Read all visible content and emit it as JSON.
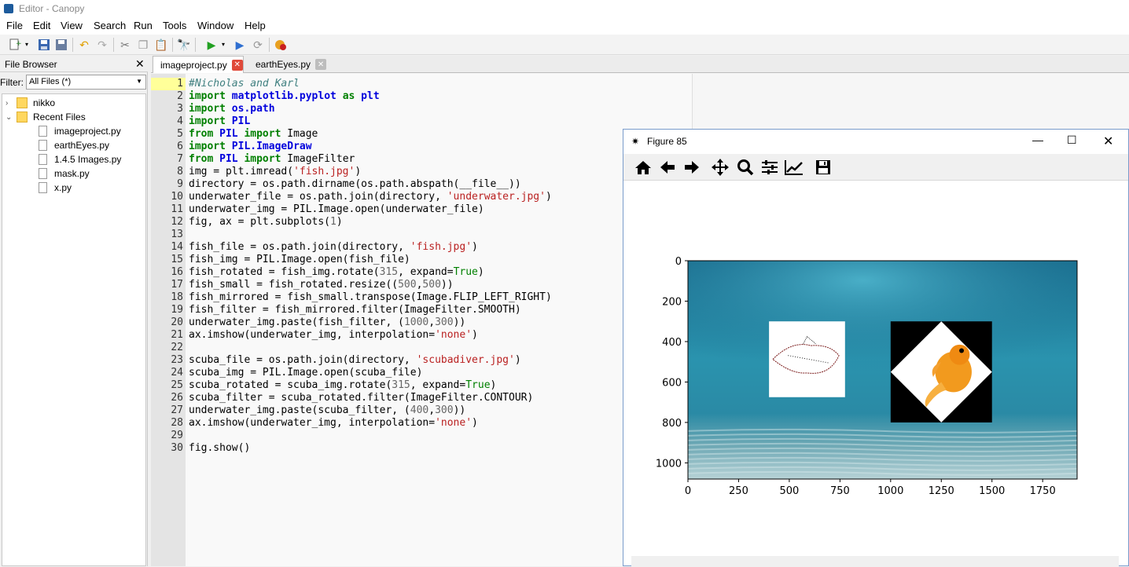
{
  "window": {
    "title": "Editor - Canopy"
  },
  "menu": [
    "File",
    "Edit",
    "View",
    "Search",
    "Run",
    "Tools",
    "Window",
    "Help"
  ],
  "file_browser": {
    "title": "File Browser",
    "filter_label": "Filter:",
    "filter_value": "All Files (*)",
    "tree": {
      "root_folder": "nikko",
      "recent_folder": "Recent Files",
      "files": [
        "imageproject.py",
        "earthEyes.py",
        "1.4.5 Images.py",
        "mask.py",
        "x.py"
      ]
    }
  },
  "tabs": [
    {
      "label": "imageproject.py",
      "active": true
    },
    {
      "label": "earthEyes.py",
      "active": false
    }
  ],
  "code_lines": [
    {
      "n": "1",
      "segs": [
        [
          "cmt",
          "#Nicholas and Karl"
        ]
      ]
    },
    {
      "n": "2",
      "segs": [
        [
          "kw",
          "import"
        ],
        [
          "",
          " "
        ],
        [
          "kw2",
          "matplotlib.pyplot"
        ],
        [
          "",
          " "
        ],
        [
          "kw",
          "as"
        ],
        [
          "",
          " "
        ],
        [
          "kw2",
          "plt"
        ]
      ]
    },
    {
      "n": "3",
      "segs": [
        [
          "kw",
          "import"
        ],
        [
          "",
          " "
        ],
        [
          "kw2",
          "os.path"
        ]
      ]
    },
    {
      "n": "4",
      "segs": [
        [
          "kw",
          "import"
        ],
        [
          "",
          " "
        ],
        [
          "kw2",
          "PIL"
        ]
      ]
    },
    {
      "n": "5",
      "segs": [
        [
          "kw",
          "from"
        ],
        [
          "",
          " "
        ],
        [
          "kw2",
          "PIL"
        ],
        [
          "",
          " "
        ],
        [
          "kw",
          "import"
        ],
        [
          "",
          " Image"
        ]
      ]
    },
    {
      "n": "6",
      "segs": [
        [
          "kw",
          "import"
        ],
        [
          "",
          " "
        ],
        [
          "kw2",
          "PIL.ImageDraw"
        ]
      ]
    },
    {
      "n": "7",
      "segs": [
        [
          "kw",
          "from"
        ],
        [
          "",
          " "
        ],
        [
          "kw2",
          "PIL"
        ],
        [
          "",
          " "
        ],
        [
          "kw",
          "import"
        ],
        [
          "",
          " ImageFilter"
        ]
      ]
    },
    {
      "n": "8",
      "segs": [
        [
          "",
          "img = plt.imread("
        ],
        [
          "str",
          "'fish.jpg'"
        ],
        [
          "",
          ")"
        ]
      ]
    },
    {
      "n": "9",
      "segs": [
        [
          "",
          "directory = os.path.dirname(os.path.abspath(__file__))"
        ]
      ]
    },
    {
      "n": "10",
      "segs": [
        [
          "",
          "underwater_file = os.path.join(directory, "
        ],
        [
          "str",
          "'underwater.jpg'"
        ],
        [
          "",
          ")"
        ]
      ]
    },
    {
      "n": "11",
      "segs": [
        [
          "",
          "underwater_img = PIL.Image.open(underwater_file)"
        ]
      ]
    },
    {
      "n": "12",
      "segs": [
        [
          "",
          "fig, ax = plt.subplots("
        ],
        [
          "num",
          "1"
        ],
        [
          "",
          ")"
        ]
      ]
    },
    {
      "n": "13",
      "segs": [
        [
          "",
          ""
        ]
      ]
    },
    {
      "n": "14",
      "segs": [
        [
          "",
          "fish_file = os.path.join(directory, "
        ],
        [
          "str",
          "'fish.jpg'"
        ],
        [
          "",
          ")"
        ]
      ]
    },
    {
      "n": "15",
      "segs": [
        [
          "",
          "fish_img = PIL.Image.open(fish_file)"
        ]
      ]
    },
    {
      "n": "16",
      "segs": [
        [
          "",
          "fish_rotated = fish_img.rotate("
        ],
        [
          "num",
          "315"
        ],
        [
          "",
          ", expand="
        ],
        [
          "cst",
          "True"
        ],
        [
          "",
          ")"
        ]
      ]
    },
    {
      "n": "17",
      "segs": [
        [
          "",
          "fish_small = fish_rotated.resize(("
        ],
        [
          "num",
          "500"
        ],
        [
          "",
          ","
        ],
        [
          "num",
          "500"
        ],
        [
          "",
          "))"
        ]
      ]
    },
    {
      "n": "18",
      "segs": [
        [
          "",
          "fish_mirrored = fish_small.transpose(Image.FLIP_LEFT_RIGHT)"
        ]
      ]
    },
    {
      "n": "19",
      "segs": [
        [
          "",
          "fish_filter = fish_mirrored.filter(ImageFilter.SMOOTH)"
        ]
      ]
    },
    {
      "n": "20",
      "segs": [
        [
          "",
          "underwater_img.paste(fish_filter, ("
        ],
        [
          "num",
          "1000"
        ],
        [
          "",
          ","
        ],
        [
          "num",
          "300"
        ],
        [
          "",
          "))"
        ]
      ]
    },
    {
      "n": "21",
      "segs": [
        [
          "",
          "ax.imshow(underwater_img, interpolation="
        ],
        [
          "str",
          "'none'"
        ],
        [
          "",
          ")"
        ]
      ]
    },
    {
      "n": "22",
      "segs": [
        [
          "",
          ""
        ]
      ]
    },
    {
      "n": "23",
      "segs": [
        [
          "",
          "scuba_file = os.path.join(directory, "
        ],
        [
          "str",
          "'scubadiver.jpg'"
        ],
        [
          "",
          ")"
        ]
      ]
    },
    {
      "n": "24",
      "segs": [
        [
          "",
          "scuba_img = PIL.Image.open(scuba_file)"
        ]
      ]
    },
    {
      "n": "25",
      "segs": [
        [
          "",
          "scuba_rotated = scuba_img.rotate("
        ],
        [
          "num",
          "315"
        ],
        [
          "",
          ", expand="
        ],
        [
          "cst",
          "True"
        ],
        [
          "",
          ")"
        ]
      ]
    },
    {
      "n": "26",
      "segs": [
        [
          "",
          "scuba_filter = scuba_rotated.filter(ImageFilter.CONTOUR)"
        ]
      ]
    },
    {
      "n": "27",
      "segs": [
        [
          "",
          "underwater_img.paste(scuba_filter, ("
        ],
        [
          "num",
          "400"
        ],
        [
          "",
          ","
        ],
        [
          "num",
          "300"
        ],
        [
          "",
          "))"
        ]
      ]
    },
    {
      "n": "28",
      "segs": [
        [
          "",
          "ax.imshow(underwater_img, interpolation="
        ],
        [
          "str",
          "'none'"
        ],
        [
          "",
          ")"
        ]
      ]
    },
    {
      "n": "29",
      "segs": [
        [
          "",
          ""
        ]
      ]
    },
    {
      "n": "30",
      "segs": [
        [
          "",
          "fig.show()"
        ]
      ]
    }
  ],
  "figure": {
    "title": "Figure 85",
    "toolbar": [
      "home-icon",
      "back-arrow-icon",
      "forward-arrow-icon",
      "pan-icon",
      "zoom-icon",
      "subplots-icon",
      "axes-edit-icon",
      "save-icon"
    ],
    "window_buttons": [
      "minimize",
      "maximize",
      "close"
    ]
  },
  "chart_data": {
    "type": "image",
    "xlim": [
      0,
      1920
    ],
    "ylim": [
      1080,
      0
    ],
    "x_ticks": [
      0,
      250,
      500,
      750,
      1000,
      1250,
      1500,
      1750
    ],
    "y_ticks": [
      0,
      200,
      400,
      600,
      800,
      1000
    ],
    "pasted_regions": [
      {
        "name": "contour",
        "x": 400,
        "y": 300,
        "w": 375,
        "h": 375
      },
      {
        "name": "fish",
        "x": 1000,
        "y": 300,
        "w": 500,
        "h": 500
      }
    ],
    "colors": {
      "water_top": "#1a6e8f",
      "water_mid": "#2a93ae",
      "water_bottom": "#b7d2d6",
      "fish": "#f29a1e"
    }
  }
}
